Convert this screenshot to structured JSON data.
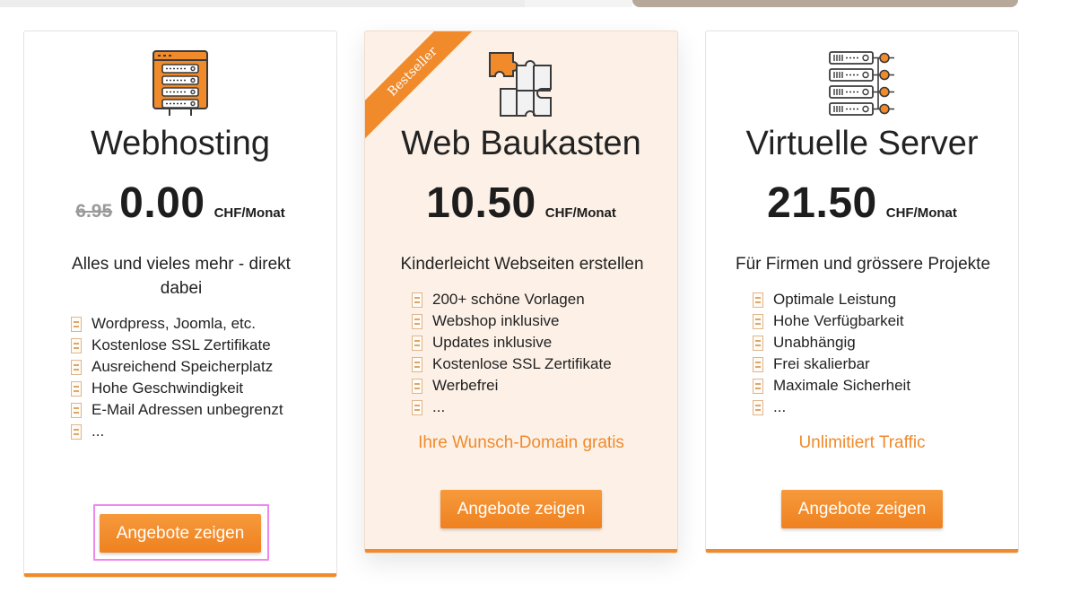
{
  "colors": {
    "accent": "#f08a2b",
    "focus": "#ee88ee",
    "highlight_card_bg": "#fdf1e7"
  },
  "cards": [
    {
      "icon": "server-window-icon",
      "title": "Webhosting",
      "old_price": "6.95",
      "price": "0.00",
      "unit": "CHF/Monat",
      "desc": "Alles und vieles mehr - direkt dabei",
      "features": [
        "Wordpress, Joomla, etc.",
        "Kostenlose SSL Zertifikate",
        "Ausreichend Speicherplatz",
        "Hohe Geschwindigkeit",
        "E-Mail Adressen unbegrenzt",
        "..."
      ],
      "highlight": "",
      "button": "Angebote zeigen"
    },
    {
      "ribbon": "Bestseller",
      "icon": "puzzle-icon",
      "title": "Web Baukasten",
      "price": "10.50",
      "unit": "CHF/Monat",
      "desc": "Kinderleicht Webseiten erstellen",
      "features": [
        "200+ schöne Vorlagen",
        "Webshop inklusive",
        "Updates inklusive",
        "Kostenlose SSL Zertifikate",
        "Werbefrei",
        "..."
      ],
      "highlight": "Ihre Wunsch-Domain gratis",
      "button": "Angebote zeigen"
    },
    {
      "icon": "server-network-icon",
      "title": "Virtuelle Server",
      "price": "21.50",
      "unit": "CHF/Monat",
      "desc": "Für Firmen und grössere Projekte",
      "features": [
        "Optimale Leistung",
        "Hohe Verfügbarkeit",
        "Unabhängig",
        "Frei skalierbar",
        "Maximale Sicherheit",
        "..."
      ],
      "highlight": "Unlimitiert Traffic",
      "button": "Angebote zeigen"
    }
  ]
}
